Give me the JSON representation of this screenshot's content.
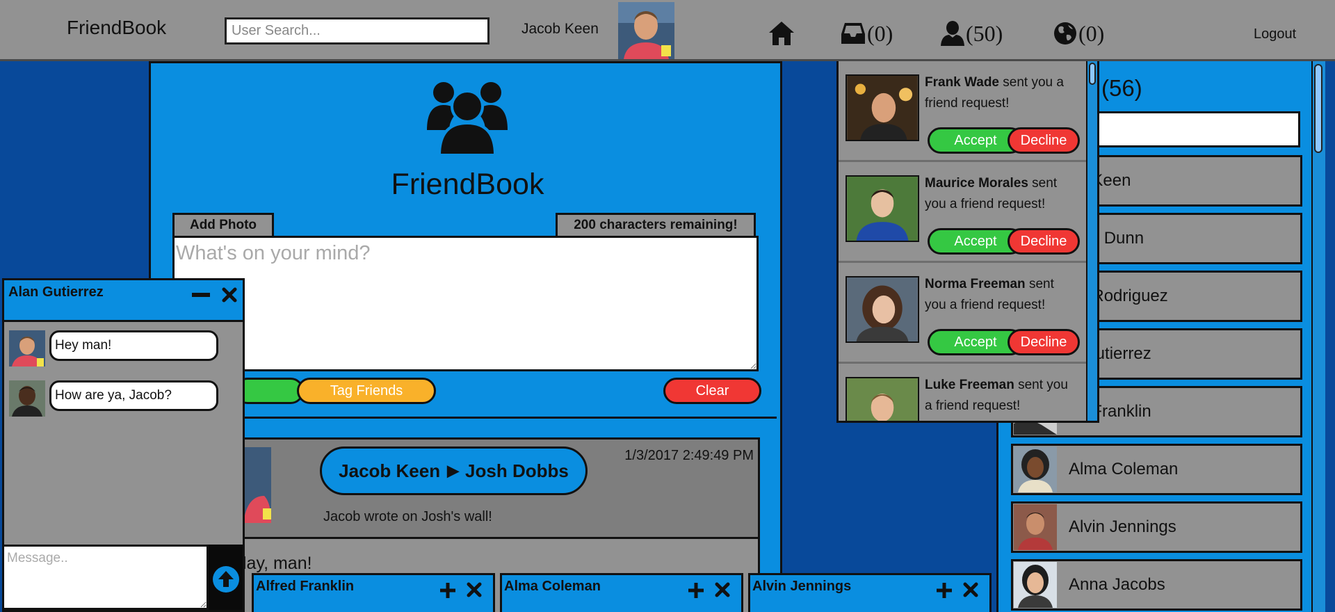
{
  "topbar": {
    "brand": "FriendBook",
    "search_placeholder": "User Search...",
    "username": "Jacob Keen",
    "inbox_count": "(0)",
    "friends_count": "(50)",
    "globe_count": "(0)",
    "logout": "Logout",
    "icons": [
      "home-icon",
      "inbox-icon",
      "person-icon",
      "globe-icon"
    ]
  },
  "main": {
    "title": "FriendBook",
    "add_photo": "Add Photo",
    "chars_remaining": "200 characters remaining!",
    "post_placeholder": "What's on your mind?",
    "tag_friends": "Tag Friends",
    "clear": "Clear"
  },
  "wall_post": {
    "from": "Jacob Keen",
    "to": "Josh Dobbs",
    "date": "1/3/2017 2:49:49 PM",
    "action": "Jacob wrote on Josh's wall!",
    "message": "birthday, man!"
  },
  "friends_panel": {
    "count": "(56)",
    "friends": [
      {
        "name": "on Keen"
      },
      {
        "name": "ison Dunn"
      },
      {
        "name": "en Rodriguez"
      },
      {
        "name": "n Gutierrez"
      },
      {
        "name": "ed Franklin"
      },
      {
        "name": "Alma Coleman"
      },
      {
        "name": "Alvin Jennings"
      },
      {
        "name": "Anna Jacobs"
      }
    ]
  },
  "friend_requests": [
    {
      "name": "Frank Wade",
      "line1": " sent you a",
      "line2": "friend request!",
      "accept": "Accept",
      "decline": "Decline"
    },
    {
      "name": "Maurice Morales",
      "line1": " sent",
      "line2": "you a friend request!",
      "accept": "Accept",
      "decline": "Decline"
    },
    {
      "name": "Norma Freeman",
      "line1": " sent",
      "line2": "you a friend request!",
      "accept": "Accept",
      "decline": "Decline"
    },
    {
      "name": "Luke Freeman",
      "line1": " sent you",
      "line2": "a friend request!",
      "accept": "Accept",
      "decline": "Decline"
    }
  ],
  "chat": {
    "title": "Alan Gutierrez",
    "messages": [
      {
        "text": "Hey man!"
      },
      {
        "text": "How are ya, Jacob?"
      }
    ],
    "input_placeholder": "Message.."
  },
  "chat_tabs": [
    {
      "name": "Alfred Franklin"
    },
    {
      "name": "Alma Coleman"
    },
    {
      "name": "Alvin Jennings"
    }
  ],
  "colors": {
    "accent_blue": "#0a8ee0",
    "background_navy": "#08499a",
    "gray": "#929292",
    "accept_green": "#35c843",
    "decline_red": "#f03734",
    "tag_orange": "#f9b12a"
  }
}
